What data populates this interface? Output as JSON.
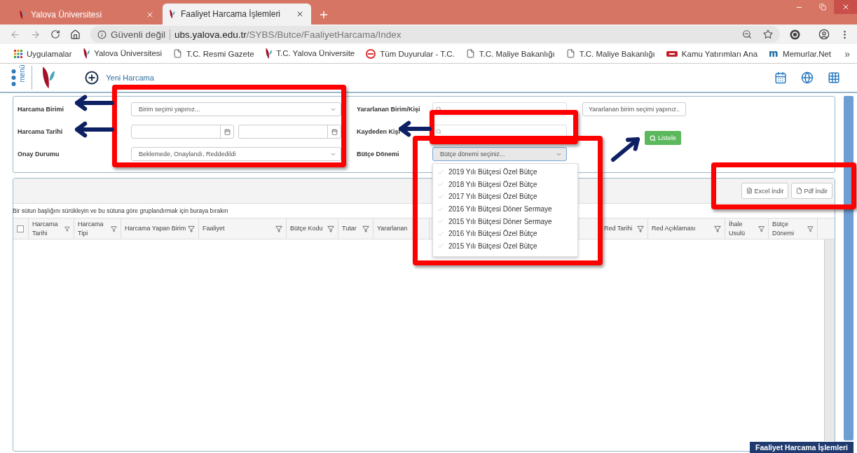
{
  "browser": {
    "tabs": [
      {
        "title": "Yalova Üniversitesi",
        "selected": false
      },
      {
        "title": "Faaliyet Harcama İşlemleri",
        "selected": true
      }
    ],
    "security": "Güvenli değil",
    "url_host": "ubs.yalova.edu.tr",
    "url_path": "/SYBS/Butce/FaaliyetHarcama/Index",
    "bookmarks": [
      {
        "kind": "apps",
        "label": "Uygulamalar"
      },
      {
        "kind": "logo",
        "label": "Yalova Üniversitesi"
      },
      {
        "kind": "page",
        "label": "T.C. Resmi Gazete"
      },
      {
        "kind": "logo",
        "label": "T.C. Yalova Üniversite"
      },
      {
        "kind": "circle",
        "label": "Tüm Duyurular - T.C."
      },
      {
        "kind": "page",
        "label": "T.C. Maliye Bakanlığı"
      },
      {
        "kind": "page",
        "label": "T.C. Maliye Bakanlığı"
      },
      {
        "kind": "flag",
        "label": "Kamu Yatırımları Ana"
      },
      {
        "kind": "m",
        "label": "Memurlar.Net"
      }
    ],
    "more": "»"
  },
  "app_header": {
    "menu_label": "menü",
    "new_button": "Yeni Harcama"
  },
  "filters": {
    "harcama_birimi": {
      "label": "Harcama Birimi",
      "placeholder": "Birim seçimi yapınız..."
    },
    "harcama_tarihi": {
      "label": "Harcama Tarihi"
    },
    "onay_durumu": {
      "label": "Onay Durumu",
      "value": "Beklemede, Onaylandı, Reddedildi"
    },
    "yararlanan": {
      "label": "Yararlanan Birim/Kişi",
      "button": "Yararlanan birim seçimi yapınız.."
    },
    "kaydeden": {
      "label": "Kaydeden Kişi"
    },
    "butce_donemi": {
      "label": "Bütçe Dönemi",
      "placeholder": "Bütçe dönemi seçiniz...",
      "expanded": true,
      "options": [
        "2019 Yılı Bütçesi Özel Bütçe",
        "2018 Yılı Bütçesi Özel Bütçe",
        "2017 Yılı Bütçesi Özel Bütçe",
        "2016 Yılı Bütçesi Döner Sermaye",
        "2015 Yılı Bütçesi Döner Sermaye",
        "2016 Yılı Bütçesi Özel Bütçe",
        "2015 Yılı Bütçesi Özel Bütçe"
      ]
    },
    "list_button": "Listele"
  },
  "grid": {
    "export_buttons": [
      {
        "kind": "excel",
        "label": "Excel İndir"
      },
      {
        "kind": "pdf",
        "label": "Pdf İndir"
      }
    ],
    "group_hint": "Bir sütun başlığını sürükleyin ve bu sütuna göre gruplandırmak için buraya bırakın",
    "select_all_checked": false,
    "columns_left": [
      "Harcama Tarihi",
      "Harcama Tipi",
      "Harcama Yapan Birim",
      "Faaliyet",
      "Bütçe Kodu",
      "Tutar",
      "Yararlanan"
    ],
    "columns_right": [
      "Red Tarihi",
      "Red Açıklaması",
      "İhale Usulü",
      "Bütçe Dönemi"
    ]
  },
  "footer_label": "Faaliyet Harcama İşlemleri"
}
